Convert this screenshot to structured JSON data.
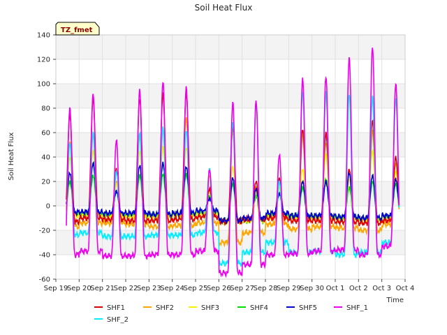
{
  "chart_data": {
    "type": "line",
    "title": "Soil Heat Flux",
    "xlabel": "Time",
    "ylabel": "Soil Heat Flux",
    "badge": "TZ_fmet",
    "ylim": [
      -60,
      140
    ],
    "yticks": [
      -60,
      -40,
      -20,
      0,
      20,
      40,
      60,
      80,
      100,
      120,
      140
    ],
    "xlim": [
      0,
      15
    ],
    "xticks": [
      {
        "pos": 0,
        "label": "Sep 19"
      },
      {
        "pos": 1,
        "label": "Sep 20"
      },
      {
        "pos": 2,
        "label": "Sep 21"
      },
      {
        "pos": 3,
        "label": "Sep 22"
      },
      {
        "pos": 4,
        "label": "Sep 23"
      },
      {
        "pos": 5,
        "label": "Sep 24"
      },
      {
        "pos": 6,
        "label": "Sep 25"
      },
      {
        "pos": 7,
        "label": "Sep 26"
      },
      {
        "pos": 8,
        "label": "Sep 27"
      },
      {
        "pos": 9,
        "label": "Sep 28"
      },
      {
        "pos": 10,
        "label": "Sep 29"
      },
      {
        "pos": 11,
        "label": "Sep 30"
      },
      {
        "pos": 12,
        "label": "Oct 1"
      },
      {
        "pos": 13,
        "label": "Oct 2"
      },
      {
        "pos": 14,
        "label": "Oct 3"
      },
      {
        "pos": 15,
        "label": "Oct 4"
      }
    ],
    "grid": true,
    "legend_position": "bottom",
    "day_labels": [
      "Sep 19",
      "Sep 20",
      "Sep 21",
      "Sep 22",
      "Sep 23",
      "Sep 24",
      "Sep 25",
      "Sep 26",
      "Sep 27",
      "Sep 28",
      "Sep 29",
      "Sep 30",
      "Oct 1",
      "Oct 2",
      "Oct 3"
    ],
    "series": [
      {
        "name": "SHF1",
        "color": "#dd0000",
        "base": [
          -13,
          -10,
          -11,
          -12,
          -12,
          -11,
          -9,
          -13,
          -11,
          -10,
          -12,
          -12,
          -13,
          -14,
          -12
        ],
        "peak": [
          75,
          88,
          30,
          88,
          92,
          92,
          14,
          65,
          20,
          22,
          63,
          60,
          30,
          70,
          40
        ]
      },
      {
        "name": "SHF2",
        "color": "#ffa500",
        "base": [
          -17,
          -14,
          -14,
          -15,
          -17,
          -16,
          -14,
          -30,
          -22,
          -15,
          -19,
          -17,
          -18,
          -20,
          -15
        ],
        "peak": [
          52,
          58,
          20,
          58,
          62,
          72,
          25,
          62,
          15,
          20,
          60,
          52,
          28,
          62,
          35
        ]
      },
      {
        "name": "SHF3",
        "color": "#ffee00",
        "base": [
          -8,
          -8,
          -9,
          -9,
          -9,
          -8,
          -7,
          -13,
          -12,
          -9,
          -10,
          -10,
          -11,
          -12,
          -10
        ],
        "peak": [
          40,
          45,
          18,
          45,
          48,
          48,
          12,
          32,
          12,
          15,
          30,
          42,
          22,
          45,
          28
        ]
      },
      {
        "name": "SHF4",
        "color": "#00dd00",
        "base": [
          -7,
          -7,
          -8,
          -8,
          -8,
          -7,
          -6,
          -12,
          -12,
          -8,
          -9,
          -9,
          -10,
          -11,
          -9
        ],
        "peak": [
          20,
          25,
          12,
          25,
          26,
          26,
          8,
          18,
          8,
          10,
          15,
          22,
          15,
          20,
          18
        ]
      },
      {
        "name": "SHF5",
        "color": "#0000cc",
        "base": [
          -5,
          -5,
          -6,
          -6,
          -7,
          -6,
          -4,
          -12,
          -10,
          -6,
          -8,
          -8,
          -9,
          -10,
          -8
        ],
        "peak": [
          27,
          35,
          12,
          33,
          35,
          32,
          6,
          23,
          14,
          10,
          20,
          20,
          27,
          25,
          22
        ]
      },
      {
        "name": "SHF_1",
        "color": "#ee00ee",
        "base": [
          -40,
          -37,
          -41,
          -41,
          -40,
          -40,
          -37,
          -55,
          -48,
          -40,
          -39,
          -37,
          -36,
          -40,
          -33
        ],
        "peak": [
          80,
          92,
          54,
          95,
          102,
          97,
          30,
          85,
          86,
          42,
          104,
          106,
          121,
          130,
          100
        ]
      },
      {
        "name": "SHF_2",
        "color": "#00eeff",
        "base": [
          -24,
          -22,
          -25,
          -25,
          -24,
          -24,
          -22,
          -47,
          -38,
          -30,
          -38,
          -37,
          -40,
          -38,
          -30
        ],
        "peak": [
          52,
          60,
          28,
          60,
          64,
          62,
          30,
          69,
          84,
          20,
          94,
          93,
          92,
          90,
          88
        ]
      }
    ]
  }
}
